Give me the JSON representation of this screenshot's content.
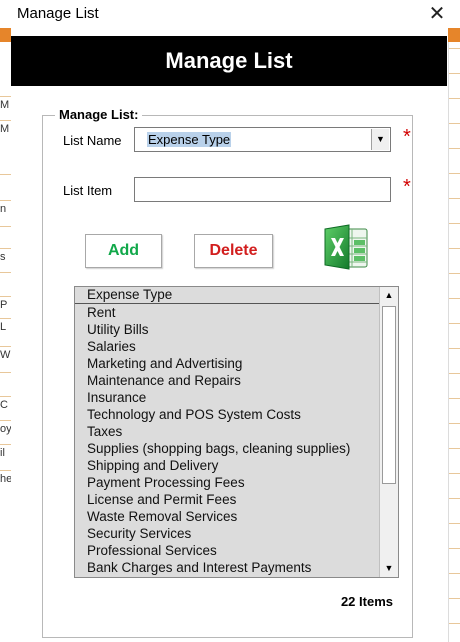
{
  "window": {
    "title": "Manage List",
    "close_glyph": "✕"
  },
  "banner": {
    "title": "Manage List"
  },
  "form": {
    "legend": "Manage List:",
    "list_name_label": "List Name",
    "list_name_value": "Expense Type",
    "list_item_label": "List Item",
    "list_item_value": "",
    "required_mark": "*",
    "dropdown_glyph": "▼"
  },
  "buttons": {
    "add_label": "Add",
    "delete_label": "Delete",
    "export_icon": "excel-icon"
  },
  "list": {
    "items": [
      "Expense Type",
      "Rent",
      "Utility Bills",
      "Salaries",
      "Marketing and Advertising",
      "Maintenance and Repairs",
      "Insurance",
      "Technology and POS System Costs",
      "Taxes",
      "Supplies (shopping bags, cleaning supplies)",
      "Shipping and Delivery",
      "Payment Processing Fees",
      "License and Permit Fees",
      "Waste Removal Services",
      "Security Services",
      "Professional Services",
      "Bank Charges and Interest Payments"
    ],
    "scroll_up_glyph": "▲",
    "scroll_down_glyph": "▼"
  },
  "footer": {
    "item_count": "22 Items"
  },
  "background_sheet": {
    "rows": [
      "M",
      "M",
      "",
      "n",
      "",
      "s",
      "",
      "P",
      "L",
      "W",
      "",
      "C",
      "oy",
      "il",
      "he"
    ]
  },
  "colors": {
    "banner_bg": "#000000",
    "add_text": "#11a84a",
    "delete_text": "#d21e1e",
    "required": "#d10000",
    "list_bg": "#dcdcdc",
    "selection": "#b9d1ea"
  }
}
